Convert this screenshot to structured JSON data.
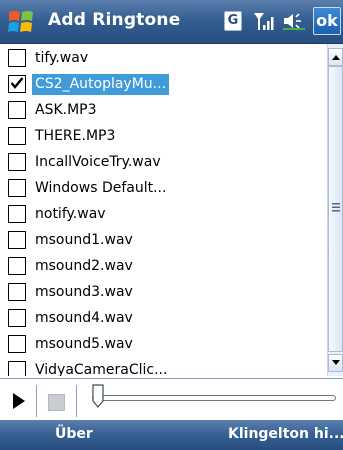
{
  "window": {
    "title": "Add Ringtone",
    "ok_label": "ok",
    "g_label": "G",
    "icons": [
      "windows-start-icon",
      "g-icon",
      "signal-icon",
      "volume-icon"
    ]
  },
  "list": {
    "items": [
      {
        "label": "tify.wav",
        "checked": false,
        "selected": false
      },
      {
        "label": "CS2_AutoplayMu...",
        "checked": true,
        "selected": true
      },
      {
        "label": "ASK.MP3",
        "checked": false,
        "selected": false
      },
      {
        "label": "THERE.MP3",
        "checked": false,
        "selected": false
      },
      {
        "label": "IncallVoiceTry.wav",
        "checked": false,
        "selected": false
      },
      {
        "label": "Windows Default...",
        "checked": false,
        "selected": false
      },
      {
        "label": "notify.wav",
        "checked": false,
        "selected": false
      },
      {
        "label": "msound1.wav",
        "checked": false,
        "selected": false
      },
      {
        "label": "msound2.wav",
        "checked": false,
        "selected": false
      },
      {
        "label": "msound3.wav",
        "checked": false,
        "selected": false
      },
      {
        "label": "msound4.wav",
        "checked": false,
        "selected": false
      },
      {
        "label": "msound5.wav",
        "checked": false,
        "selected": false
      },
      {
        "label": "VidyaCameraClic...",
        "checked": false,
        "selected": false
      }
    ],
    "selected_color": "#3f9bd9"
  },
  "player": {
    "controls": [
      "play-icon",
      "stop-icon"
    ],
    "progress": 0
  },
  "menubar": {
    "left_label": "Über",
    "right_label": "Klingelton hi..."
  },
  "colors": {
    "titlebar": "#355f92",
    "accent": "#3f9bd9"
  }
}
